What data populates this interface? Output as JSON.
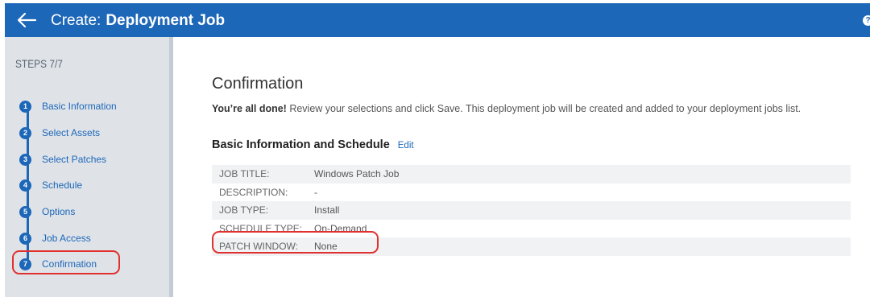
{
  "header": {
    "title_prefix": "Create:",
    "title_main": "Deployment Job",
    "help_icon": "?"
  },
  "sidebar": {
    "steps_label": "STEPS 7/7",
    "steps": [
      {
        "num": "1",
        "label": "Basic Information"
      },
      {
        "num": "2",
        "label": "Select Assets"
      },
      {
        "num": "3",
        "label": "Select Patches"
      },
      {
        "num": "4",
        "label": "Schedule"
      },
      {
        "num": "5",
        "label": "Options"
      },
      {
        "num": "6",
        "label": "Job Access"
      },
      {
        "num": "7",
        "label": "Confirmation"
      }
    ],
    "active_step": "Confirmation"
  },
  "main": {
    "title": "Confirmation",
    "intro_bold": "You’re all done!",
    "intro_rest": " Review your selections and click Save. This deployment job will be created and added to your deployment jobs list.",
    "section_title": "Basic Information and Schedule",
    "edit_label": "Edit",
    "rows": [
      {
        "label": "JOB TITLE:",
        "value": "Windows Patch Job"
      },
      {
        "label": "DESCRIPTION:",
        "value": "-"
      },
      {
        "label": "JOB TYPE:",
        "value": "Install"
      },
      {
        "label": "SCHEDULE TYPE:",
        "value": "On-Demand"
      },
      {
        "label": "PATCH WINDOW:",
        "value": "None"
      }
    ]
  },
  "colors": {
    "primary": "#1d67b8",
    "highlight": "#e0312f",
    "sidebar_bg": "#dfe3e8"
  }
}
